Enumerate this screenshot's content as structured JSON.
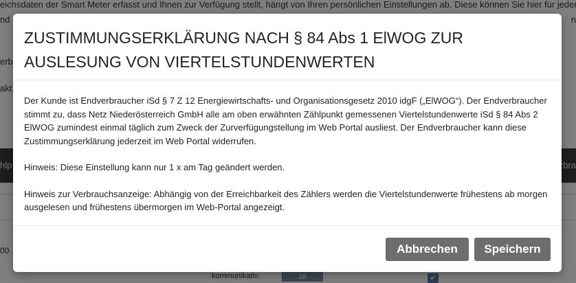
{
  "background": {
    "line1": "eichsdaten der Smart Meter erfasst und Ihnen zur Verfügung stellt, hängt von Ihren persönlichen Einstellungen ab. Diese können Sie hier für jeden",
    "line2": "nd a",
    "line2_right": "n",
    "line3": "erb",
    "line4": "akt",
    "bar_left": "hlp",
    "bar_right": "erbra",
    "row_number": "00",
    "kommunikativ_label": "kommunikativ:",
    "ja_value": "JA",
    "check_glyph": "✔"
  },
  "modal": {
    "title": "ZUSTIMMUNGSERKLÄRUNG NACH § 84 Abs 1 ElWOG ZUR AUSLESUNG VON VIERTELSTUNDENWERTEN",
    "paragraph1": "Der Kunde ist Endverbraucher iSd § 7 Z 12 Energiewirtschafts- und Organisationsgesetz 2010 idgF („ElWOG“). Der Endverbraucher stimmt zu, dass Netz Niederösterreich GmbH alle am oben erwähnten Zählpunkt gemessenen Viertelstundenwerte iSd § 84 Abs 2 ElWOG zumindest einmal täglich zum Zweck der Zurverfügungstellung im Web Portal ausliest. Der Endverbraucher kann diese Zustimmungserklärung jederzeit  im Web Portal widerrufen.",
    "paragraph2": "Hinweis: Diese Einstellung kann nur 1 x am Tag geändert werden.",
    "paragraph3": "Hinweis zur Verbrauchsanzeige: Abhängig von der Erreichbarkeit des Zählers werden die Viertelstundenwerte frühestens ab morgen ausgelesen und frühestens übermorgen im Web-Portal angezeigt.",
    "cancel_label": "Abbrechen",
    "save_label": "Speichern"
  },
  "colors": {
    "button_bg": "#6d6d6d",
    "overlay": "rgba(0,0,0,0.5)"
  }
}
